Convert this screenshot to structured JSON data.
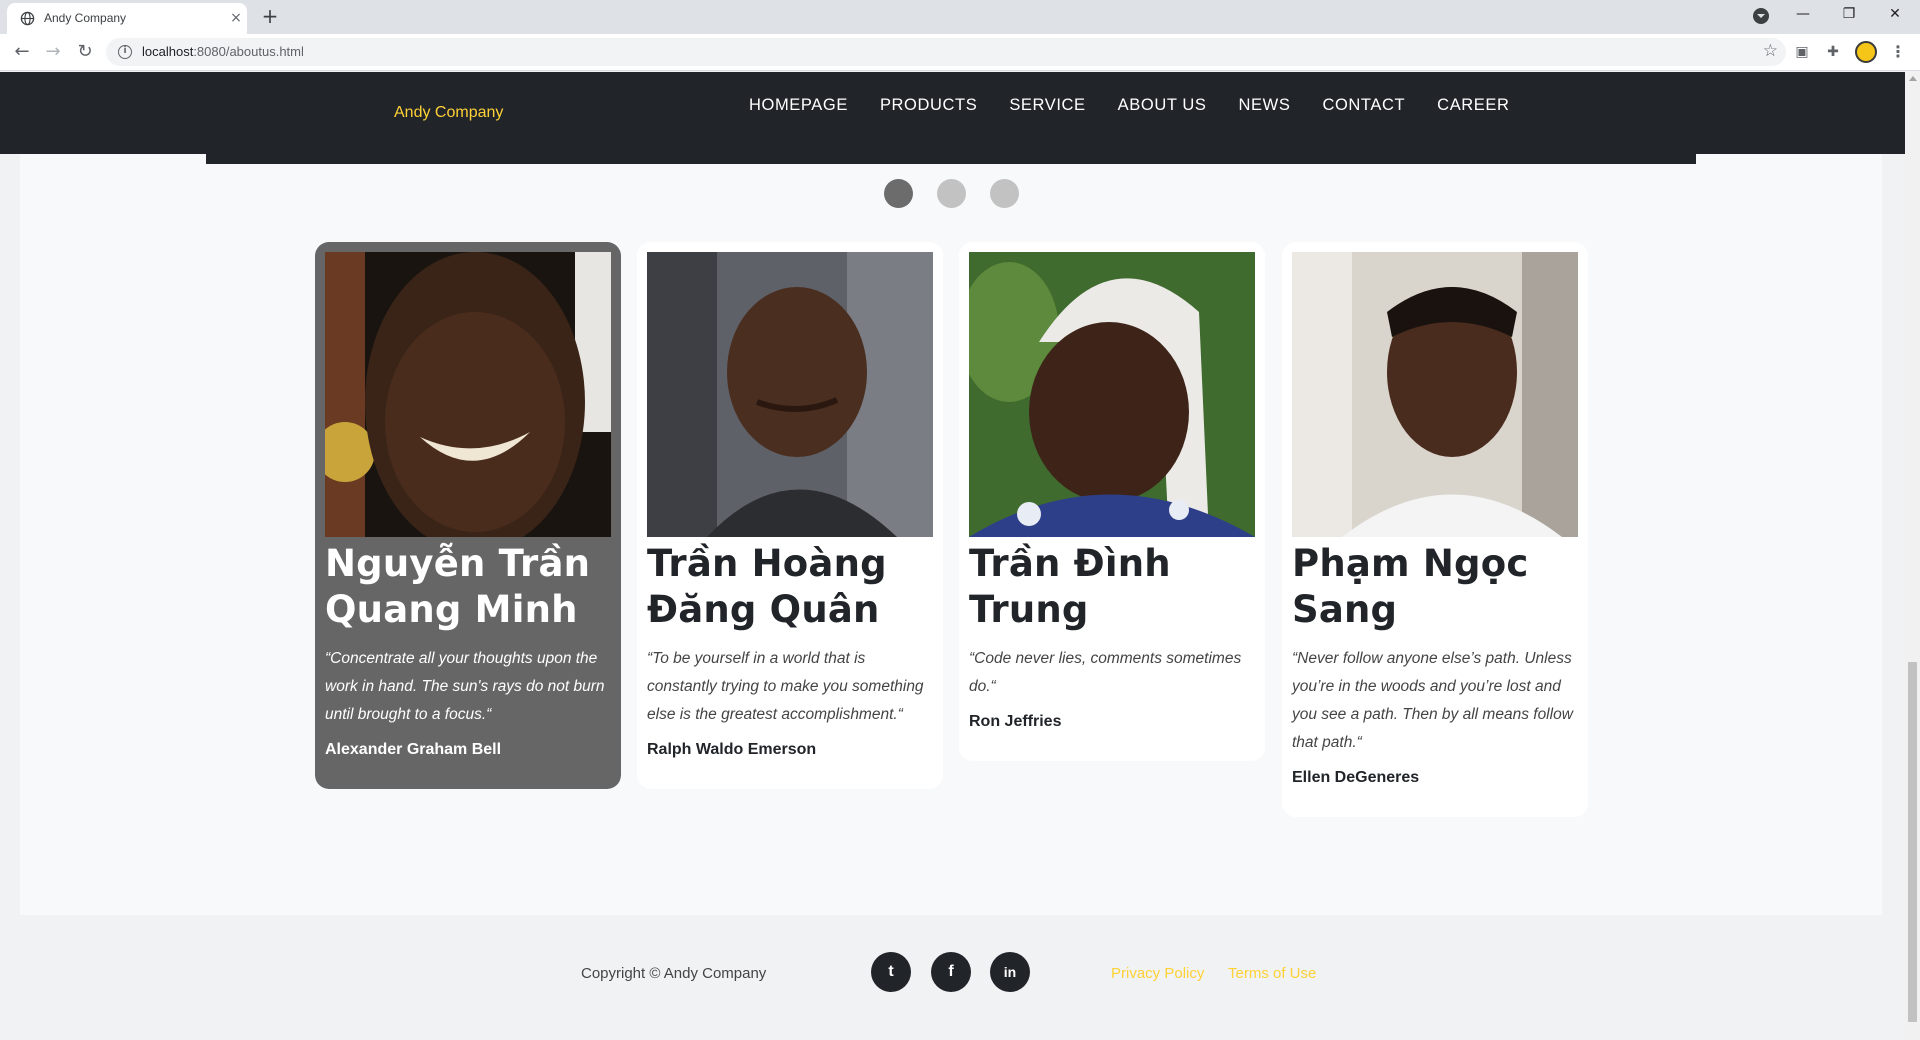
{
  "browser": {
    "tab_title": "Andy Company",
    "tab_close": "×",
    "new_tab": "+",
    "url_host": "localhost",
    "url_path": ":8080/aboutus.html",
    "win_minimize": "—",
    "win_restore": "❐",
    "win_close": "✕"
  },
  "nav": {
    "brand": "Andy Company",
    "links": [
      "HOMEPAGE",
      "PRODUCTS",
      "SERVICE",
      "ABOUT US",
      "NEWS",
      "CONTACT",
      "CAREER"
    ]
  },
  "carousel": {
    "dots": 3,
    "active_index": 0
  },
  "team": [
    {
      "name": "Nguyễn Trần Quang Minh",
      "quote": "“Concentrate all your thoughts upon the work in hand. The sun's rays do not burn until brought to a focus.“",
      "author": "Alexander Graham Bell"
    },
    {
      "name": "Trần Hoàng Đăng Quân",
      "quote": "“To be yourself in a world that is constantly trying to make you something else is the greatest accomplishment.“",
      "author": "Ralph Waldo Emerson"
    },
    {
      "name": "Trần Đình Trung",
      "quote": "“Code never lies, comments sometimes do.“",
      "author": "Ron Jeffries"
    },
    {
      "name": "Phạm Ngọc Sang",
      "quote": "“Never follow anyone else’s path. Unless you’re in the woods and you’re lost and you see a path. Then by all means follow that path.“",
      "author": "Ellen DeGeneres"
    }
  ],
  "footer": {
    "copyright": "Copyright © Andy Company",
    "social": [
      {
        "icon": "twitter-icon",
        "glyph": "t"
      },
      {
        "icon": "facebook-icon",
        "glyph": "f"
      },
      {
        "icon": "linkedin-icon",
        "glyph": "in"
      }
    ],
    "privacy": "Privacy Policy",
    "terms": "Terms of Use"
  },
  "colors": {
    "accent": "#fed136",
    "dark": "#212529",
    "active_card": "#666667"
  }
}
